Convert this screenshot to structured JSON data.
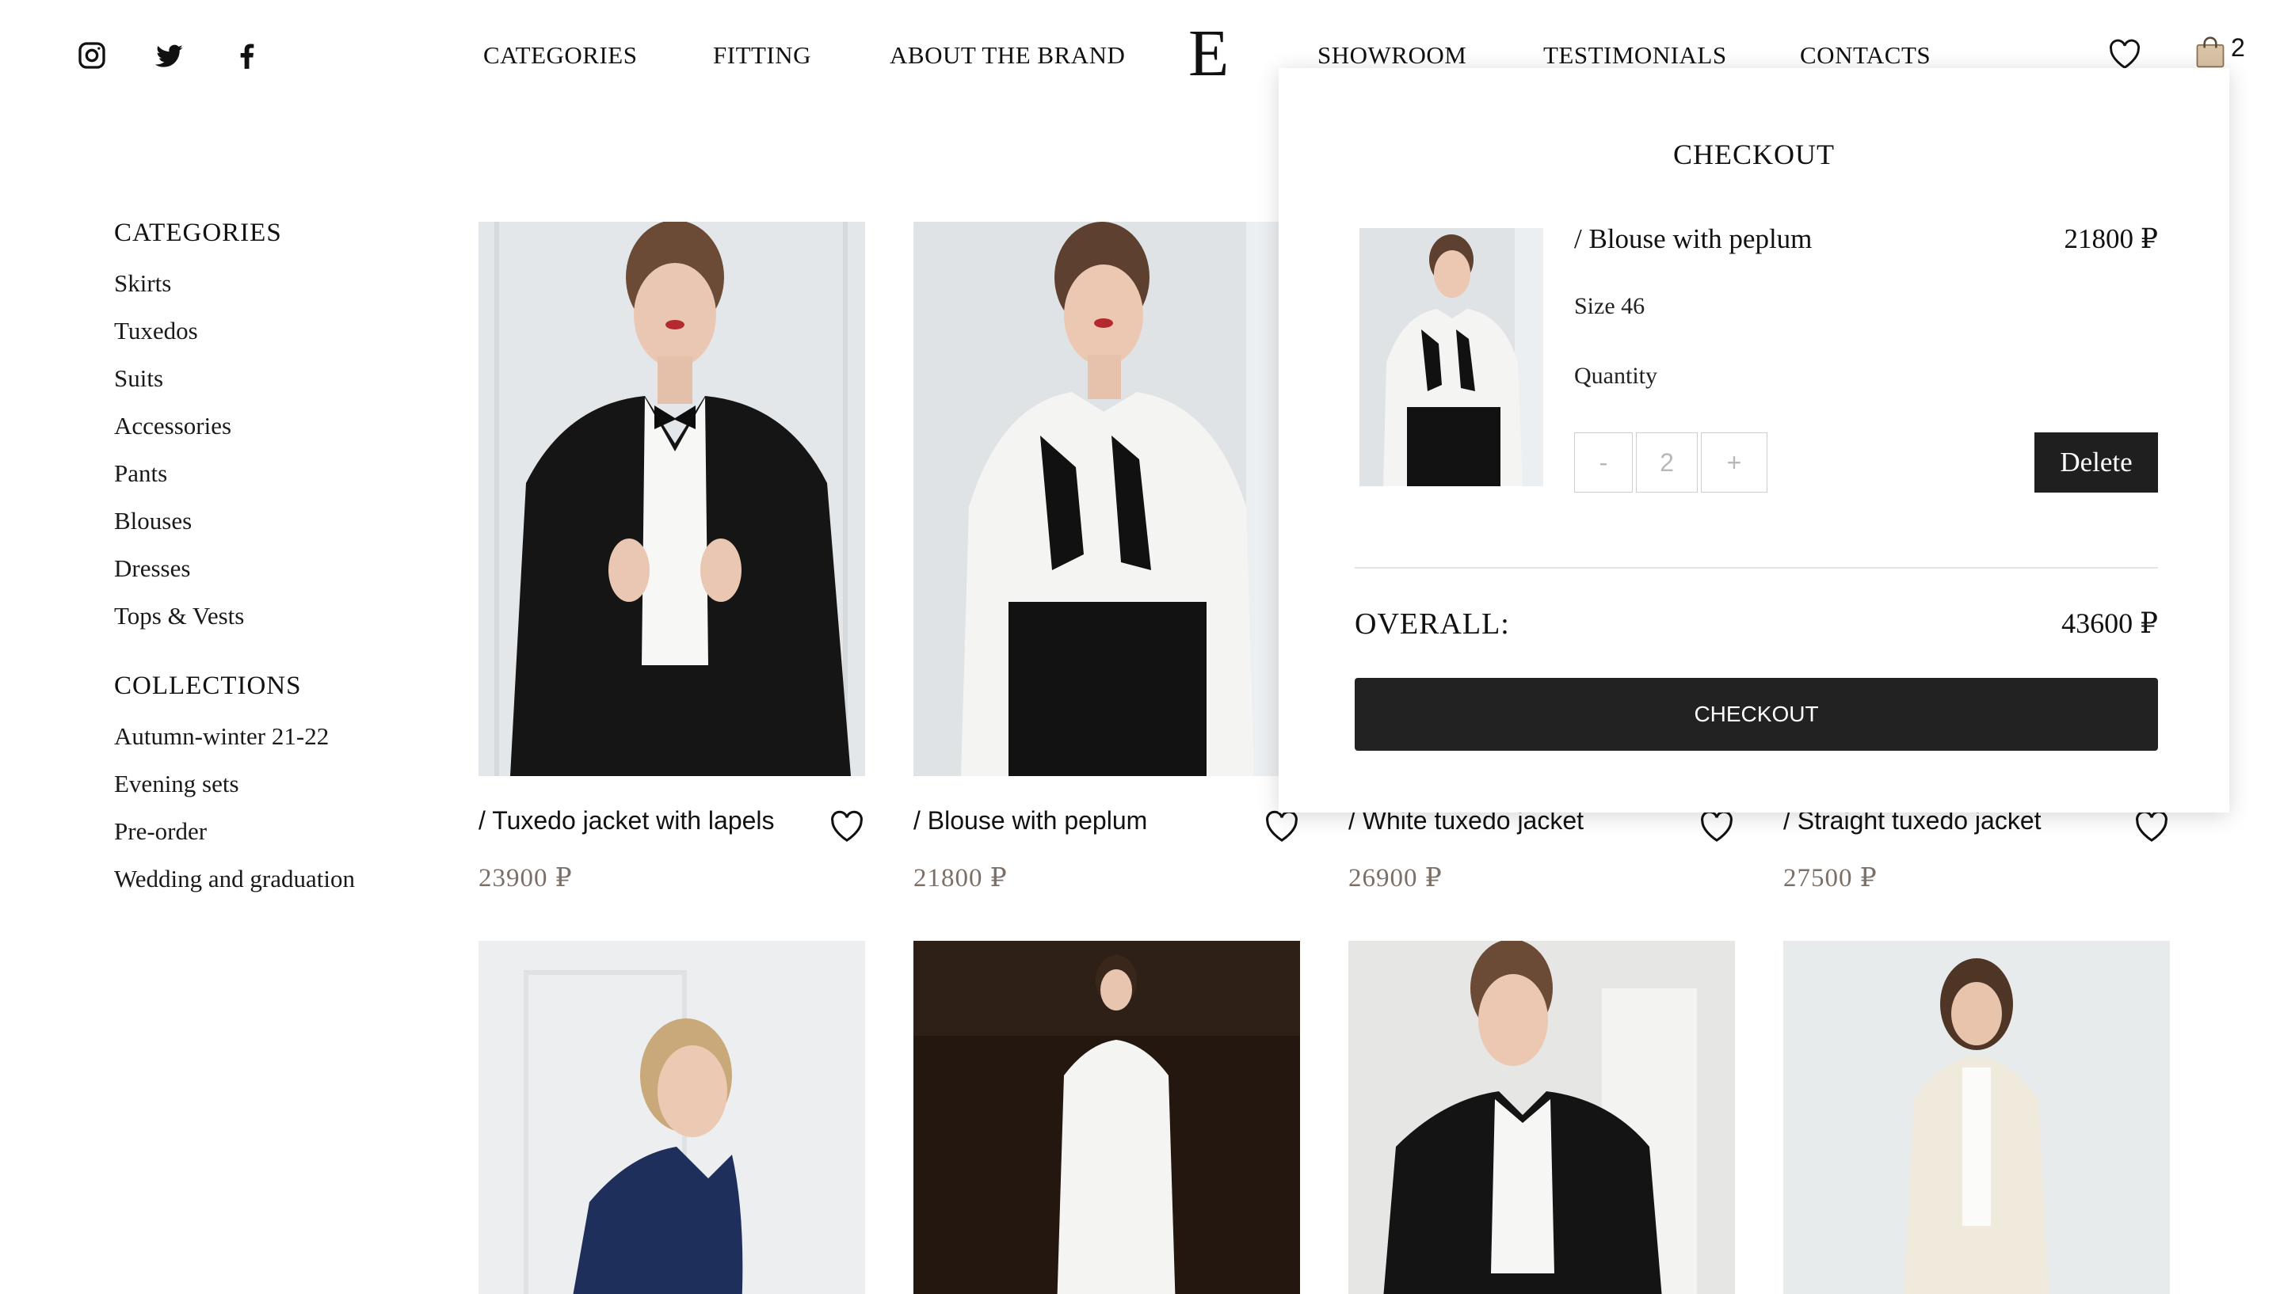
{
  "header": {
    "social_icons": [
      "instagram-icon",
      "twitter-icon",
      "facebook-icon"
    ],
    "nav_left": [
      "CATEGORIES",
      "FITTING",
      "ABOUT THE BRAND"
    ],
    "logo": "E",
    "nav_right": [
      "SHOWROOM",
      "TESTIMONIALS",
      "CONTACTS"
    ],
    "cart_count": "2"
  },
  "sidebar": {
    "categories_title": "CATEGORIES",
    "categories": [
      "Skirts",
      "Tuxedos",
      "Suits",
      "Accessories",
      "Pants",
      "Blouses",
      "Dresses",
      "Tops & Vests"
    ],
    "collections_title": "COLLECTIONS",
    "collections": [
      "Autumn-winter 21-22",
      "Evening sets",
      "Pre-order",
      "Wedding and graduation"
    ]
  },
  "products": [
    {
      "name": "/ Tuxedo jacket with lapels",
      "price": "23900 ₽"
    },
    {
      "name": "/ Blouse with peplum",
      "price": "21800 ₽"
    },
    {
      "name": "/ White tuxedo jacket",
      "price": "26900 ₽"
    },
    {
      "name": "/ Straight tuxedo jacket",
      "price": "27500 ₽"
    }
  ],
  "checkout_popup": {
    "title": "CHECKOUT",
    "item": {
      "name": "/ Blouse with peplum",
      "price": "21800 ₽",
      "size": "Size 46",
      "quantity_label": "Quantity",
      "quantity_minus": "-",
      "quantity_value": "2",
      "quantity_plus": "+",
      "delete_label": "Delete"
    },
    "overall_label": "OVERALL:",
    "overall_value": "43600 ₽",
    "checkout_label": "CHECKOUT"
  },
  "colors": {
    "text": "#111111",
    "price_muted": "#7b7068",
    "dark_button": "#222222",
    "border": "#cfcfcf"
  }
}
